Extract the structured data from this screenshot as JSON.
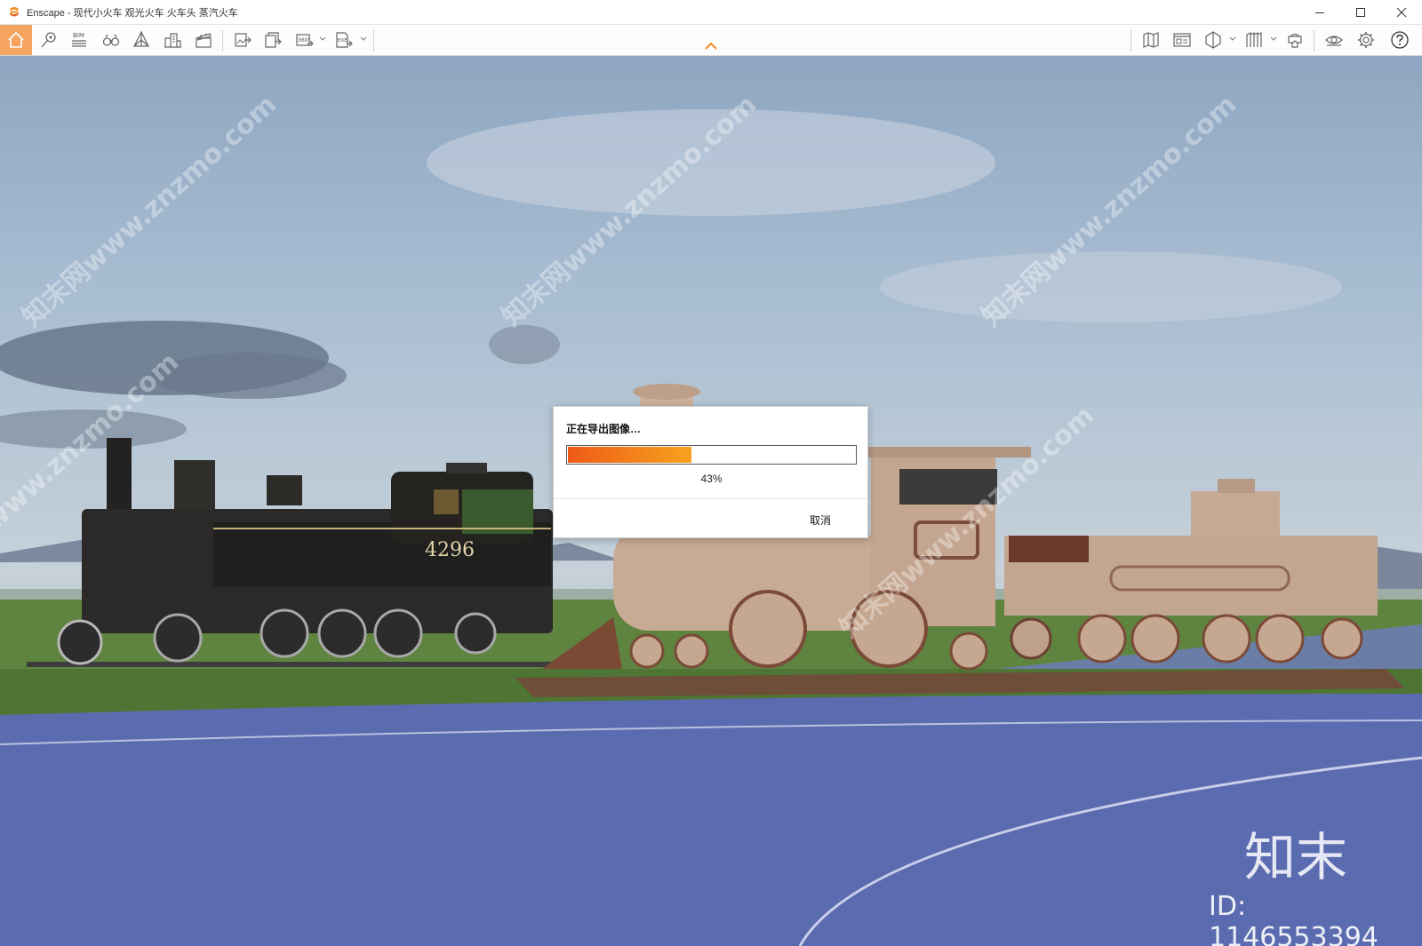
{
  "window": {
    "title": "Enscape - 现代小火车 观光火车 火车头 蒸汽火车",
    "controls": [
      "minimize-icon",
      "maximize-icon",
      "close-icon"
    ]
  },
  "toolbar": {
    "left_icons": [
      "home-icon",
      "location-pin-icon",
      "bim-icon",
      "binoculars-icon",
      "perspective-icon",
      "buildings-icon",
      "clapper-icon",
      "export-image-icon",
      "export-batch-icon",
      "export-panorama-icon",
      "export-exe-icon"
    ],
    "bim_label": "BIM",
    "pano_label": "360°",
    "exe_label": "EXE",
    "right_icons": [
      "map-icon",
      "asset-library-icon",
      "section-icon",
      "material-icon",
      "vr-headset-icon",
      "visual-settings-icon",
      "settings-icon",
      "help-icon"
    ],
    "accent": "#f5a561"
  },
  "dialog": {
    "title": "正在导出图像…",
    "progress": 0.43,
    "progress_label": "43%",
    "cancel_label": "取消"
  },
  "scene": {
    "locomotive_number": "4296",
    "watermark_brand": "知末",
    "watermark_id": "ID: 1146553394",
    "watermark_text": "知末网www.znzmo.com"
  }
}
